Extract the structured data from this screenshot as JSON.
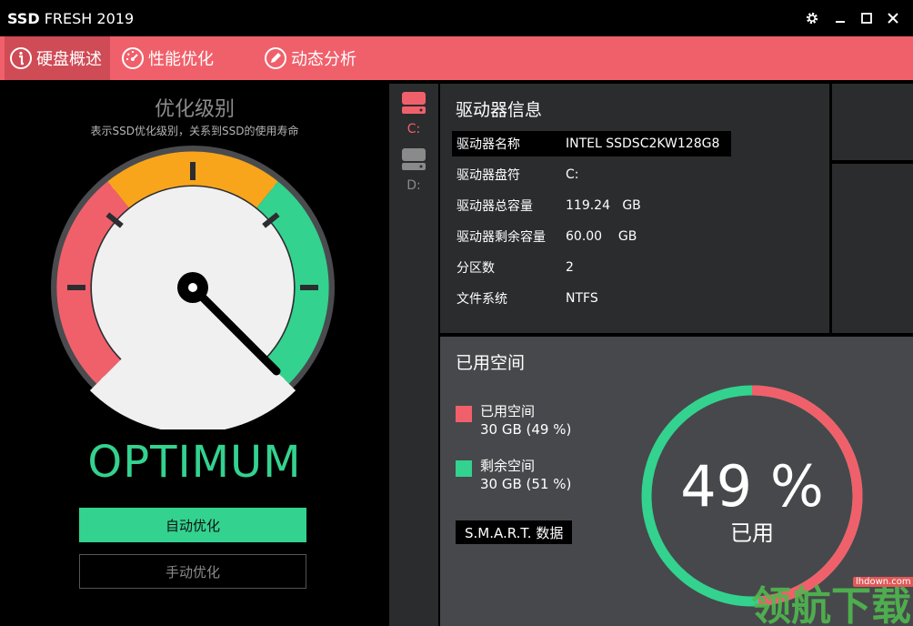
{
  "app": {
    "title_bold": "SSD",
    "title_rest": "FRESH 2019"
  },
  "window_controls": {
    "settings": "gear-icon",
    "minimize": "minimize-icon",
    "maximize": "maximize-icon",
    "close": "close-icon"
  },
  "tabs": [
    {
      "label": "硬盘概述",
      "icon": "info-icon",
      "active": true
    },
    {
      "label": "性能优化",
      "icon": "speedometer-icon",
      "active": false
    },
    {
      "label": "动态分析",
      "icon": "pencil-icon",
      "active": false
    }
  ],
  "optimization": {
    "title": "优化级别",
    "subtitle": "表示SSD优化级别，关系到SSD的使用寿命",
    "status": "OPTIMUM",
    "auto_button": "自动优化",
    "manual_button": "手动优化"
  },
  "drives": [
    {
      "letter": "C:",
      "selected": true,
      "color": "#f0606b"
    },
    {
      "letter": "D:",
      "selected": false,
      "color": "#8a8a8a"
    }
  ],
  "drive_info": {
    "title": "驱动器信息",
    "rows": [
      {
        "key": "驱动器名称",
        "value": "INTEL SSDSC2KW128G8"
      },
      {
        "key": "驱动器盘符",
        "value": "C:"
      },
      {
        "key": "驱动器总容量",
        "value": "119.24   GB"
      },
      {
        "key": "驱动器剩余容量",
        "value": "60.00    GB"
      },
      {
        "key": "分区数",
        "value": "2"
      },
      {
        "key": "文件系统",
        "value": "NTFS"
      }
    ]
  },
  "used_space": {
    "title": "已用空间",
    "used_label": "已用空间",
    "used_value": "30 GB (49 %)",
    "free_label": "剩余空间",
    "free_value": "30 GB (51 %)",
    "smart_button": "S.M.A.R.T. 数据",
    "percent_text": "49 %",
    "percent_label": "已用",
    "used_fraction": 0.49
  },
  "colors": {
    "accent": "#f0606b",
    "green": "#33d28f",
    "orange": "#f8a51c"
  },
  "watermark": {
    "url": "lhdown.com",
    "text": "领航下载"
  }
}
